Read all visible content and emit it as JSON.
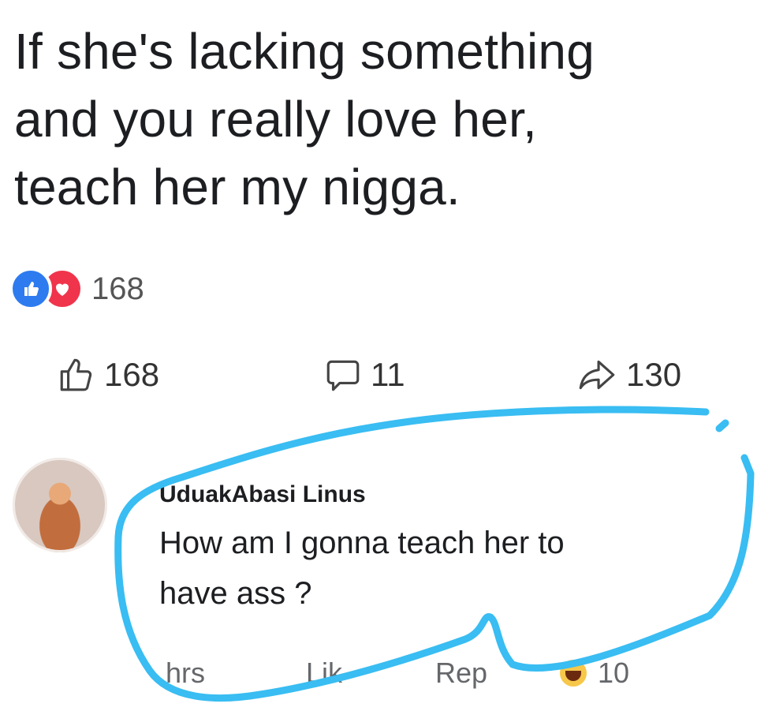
{
  "post": {
    "text_lines": [
      "If she's lacking something",
      "and you really love her,",
      "teach her my nigga."
    ]
  },
  "reactions": {
    "types": [
      "like",
      "love"
    ],
    "count": "168"
  },
  "actions": {
    "likes": "168",
    "comments": "11",
    "shares": "130"
  },
  "comment": {
    "author": "UduakAbasi Linus",
    "text_lines": [
      "How am I gonna teach her to",
      "have ass ?"
    ],
    "time": "hrs",
    "like_label": "Lik",
    "reply_label": "Rep",
    "reaction_count": "10"
  },
  "colors": {
    "like_blue": "#2e7bf0",
    "love_red": "#f0344c",
    "highlight_stroke": "#39bdf2"
  },
  "icons": [
    "like-reaction-icon",
    "love-reaction-icon",
    "thumbs-up-icon",
    "comment-icon",
    "share-icon",
    "haha-reaction-icon"
  ]
}
